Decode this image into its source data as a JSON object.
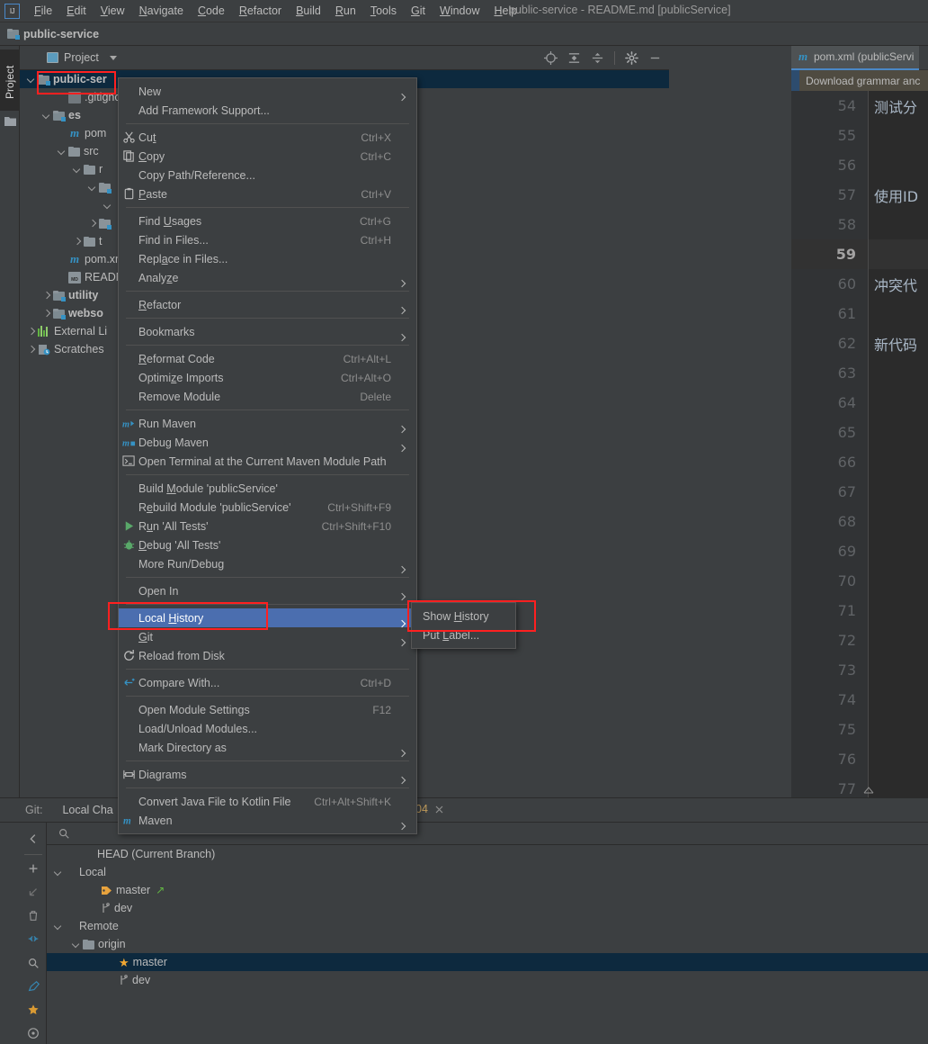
{
  "window": {
    "title": "public-service - README.md [publicService]",
    "logo": "IJ"
  },
  "menubar": {
    "items": [
      {
        "label": "File"
      },
      {
        "label": "Edit"
      },
      {
        "label": "View"
      },
      {
        "label": "Navigate"
      },
      {
        "label": "Code"
      },
      {
        "label": "Refactor"
      },
      {
        "label": "Build"
      },
      {
        "label": "Run"
      },
      {
        "label": "Tools"
      },
      {
        "label": "Git"
      },
      {
        "label": "Window"
      },
      {
        "label": "Help"
      }
    ]
  },
  "navbar": {
    "crumb": "public-service"
  },
  "left_stripe": {
    "tab_label": "Project"
  },
  "project_panel": {
    "title": "Project",
    "tools": [
      "locate-icon",
      "expand-all-icon",
      "collapse-all-icon",
      "settings-icon",
      "hide-icon"
    ],
    "tree": [
      {
        "label": "public-ser",
        "indent": 0,
        "arrow": "down",
        "icon": "module-folder",
        "bold": true,
        "selected": true
      },
      {
        "label": ".gitigno",
        "indent": 2,
        "arrow": "none",
        "icon": "gitignore",
        "bold": false,
        "selected": false
      },
      {
        "label": "es",
        "indent": 1,
        "arrow": "down",
        "icon": "module-folder",
        "bold": true,
        "selected": false
      },
      {
        "label": "pom",
        "indent": 2,
        "arrow": "none",
        "icon": "maven",
        "bold": false,
        "selected": false
      },
      {
        "label": "src",
        "indent": 2,
        "arrow": "down",
        "icon": "folder",
        "bold": false,
        "selected": false
      },
      {
        "label": "r",
        "indent": 3,
        "arrow": "down",
        "icon": "folder",
        "bold": false,
        "selected": false
      },
      {
        "label": "",
        "indent": 4,
        "arrow": "down",
        "icon": "folder-blue",
        "bold": false,
        "selected": false
      },
      {
        "label": "",
        "indent": 5,
        "arrow": "down",
        "icon": "none",
        "bold": false,
        "selected": false
      },
      {
        "label": "",
        "indent": 4,
        "arrow": "right",
        "icon": "folder-blue",
        "bold": false,
        "selected": false
      },
      {
        "label": "t",
        "indent": 3,
        "arrow": "right",
        "icon": "folder",
        "bold": false,
        "selected": false
      },
      {
        "label": "pom.xm",
        "indent": 2,
        "arrow": "none",
        "icon": "maven",
        "bold": false,
        "selected": false
      },
      {
        "label": "READM",
        "indent": 2,
        "arrow": "none",
        "icon": "markdown",
        "bold": false,
        "selected": false
      },
      {
        "label": "utility",
        "indent": 1,
        "arrow": "right",
        "icon": "module-folder",
        "bold": true,
        "selected": false
      },
      {
        "label": "webso",
        "indent": 1,
        "arrow": "right",
        "icon": "module-folder",
        "bold": true,
        "selected": false
      },
      {
        "label": "External Li",
        "indent": 0,
        "arrow": "right",
        "icon": "library",
        "bold": false,
        "selected": false
      },
      {
        "label": "Scratches",
        "indent": 0,
        "arrow": "right",
        "icon": "scratch",
        "bold": false,
        "selected": false
      }
    ]
  },
  "context_menu": {
    "items": [
      {
        "type": "item",
        "label": "New",
        "mnemonic": "",
        "shortcut": "",
        "submenu": true,
        "icon": ""
      },
      {
        "type": "item",
        "label": "Add Framework Support...",
        "shortcut": "",
        "submenu": false,
        "icon": ""
      },
      {
        "type": "separator"
      },
      {
        "type": "item",
        "label": "Cut",
        "mnemonic": "t",
        "shortcut": "Ctrl+X",
        "submenu": false,
        "icon": "scissors-icon"
      },
      {
        "type": "item",
        "label": "Copy",
        "mnemonic": "C",
        "shortcut": "Ctrl+C",
        "submenu": false,
        "icon": "copy-icon"
      },
      {
        "type": "item",
        "label": "Copy Path/Reference...",
        "shortcut": "",
        "submenu": false,
        "icon": ""
      },
      {
        "type": "item",
        "label": "Paste",
        "mnemonic": "P",
        "shortcut": "Ctrl+V",
        "submenu": false,
        "icon": "clipboard-icon"
      },
      {
        "type": "separator"
      },
      {
        "type": "item",
        "label": "Find Usages",
        "mnemonic": "U",
        "shortcut": "Ctrl+G",
        "submenu": false,
        "icon": ""
      },
      {
        "type": "item",
        "label": "Find in Files...",
        "shortcut": "Ctrl+H",
        "submenu": false,
        "icon": ""
      },
      {
        "type": "item",
        "label": "Replace in Files...",
        "mnemonic": "a",
        "shortcut": "",
        "submenu": false,
        "icon": ""
      },
      {
        "type": "item",
        "label": "Analyze",
        "mnemonic": "z",
        "shortcut": "",
        "submenu": true,
        "icon": ""
      },
      {
        "type": "separator"
      },
      {
        "type": "item",
        "label": "Refactor",
        "mnemonic": "R",
        "shortcut": "",
        "submenu": true,
        "icon": ""
      },
      {
        "type": "separator"
      },
      {
        "type": "item",
        "label": "Bookmarks",
        "shortcut": "",
        "submenu": true,
        "icon": ""
      },
      {
        "type": "separator"
      },
      {
        "type": "item",
        "label": "Reformat Code",
        "mnemonic": "R",
        "shortcut": "Ctrl+Alt+L",
        "submenu": false,
        "icon": ""
      },
      {
        "type": "item",
        "label": "Optimize Imports",
        "mnemonic": "z",
        "shortcut": "Ctrl+Alt+O",
        "submenu": false,
        "icon": ""
      },
      {
        "type": "item",
        "label": "Remove Module",
        "shortcut": "Delete",
        "submenu": false,
        "icon": ""
      },
      {
        "type": "separator"
      },
      {
        "type": "item",
        "label": "Run Maven",
        "shortcut": "",
        "submenu": true,
        "icon": "maven-run-icon"
      },
      {
        "type": "item",
        "label": "Debug Maven",
        "shortcut": "",
        "submenu": true,
        "icon": "maven-debug-icon"
      },
      {
        "type": "item",
        "label": "Open Terminal at the Current Maven Module Path",
        "shortcut": "",
        "submenu": false,
        "icon": "terminal-icon"
      },
      {
        "type": "separator"
      },
      {
        "type": "item",
        "label": "Build Module 'publicService'",
        "mnemonic": "M",
        "shortcut": "",
        "submenu": false,
        "icon": ""
      },
      {
        "type": "item",
        "label": "Rebuild Module 'publicService'",
        "mnemonic": "e",
        "shortcut": "Ctrl+Shift+F9",
        "submenu": false,
        "icon": ""
      },
      {
        "type": "item",
        "label": "Run 'All Tests'",
        "mnemonic": "u",
        "shortcut": "Ctrl+Shift+F10",
        "submenu": false,
        "icon": "run-icon"
      },
      {
        "type": "item",
        "label": "Debug 'All Tests'",
        "mnemonic": "D",
        "shortcut": "",
        "submenu": false,
        "icon": "debug-icon"
      },
      {
        "type": "item",
        "label": "More Run/Debug",
        "shortcut": "",
        "submenu": true,
        "icon": ""
      },
      {
        "type": "separator"
      },
      {
        "type": "item",
        "label": "Open In",
        "shortcut": "",
        "submenu": true,
        "icon": ""
      },
      {
        "type": "separator"
      },
      {
        "type": "item",
        "label": "Local History",
        "mnemonic": "H",
        "shortcut": "",
        "submenu": true,
        "icon": "",
        "highlighted": true
      },
      {
        "type": "item",
        "label": "Git",
        "mnemonic": "G",
        "shortcut": "",
        "submenu": true,
        "icon": ""
      },
      {
        "type": "item",
        "label": "Reload from Disk",
        "shortcut": "",
        "submenu": false,
        "icon": "reload-icon"
      },
      {
        "type": "separator"
      },
      {
        "type": "item",
        "label": "Compare With...",
        "shortcut": "Ctrl+D",
        "submenu": false,
        "icon": "compare-icon"
      },
      {
        "type": "separator"
      },
      {
        "type": "item",
        "label": "Open Module Settings",
        "shortcut": "F12",
        "submenu": false,
        "icon": ""
      },
      {
        "type": "item",
        "label": "Load/Unload Modules...",
        "shortcut": "",
        "submenu": false,
        "icon": ""
      },
      {
        "type": "item",
        "label": "Mark Directory as",
        "shortcut": "",
        "submenu": true,
        "icon": ""
      },
      {
        "type": "separator"
      },
      {
        "type": "item",
        "label": "Diagrams",
        "shortcut": "",
        "submenu": true,
        "icon": "diagram-icon"
      },
      {
        "type": "separator"
      },
      {
        "type": "item",
        "label": "Convert Java File to Kotlin File",
        "shortcut": "Ctrl+Alt+Shift+K",
        "submenu": false,
        "icon": ""
      },
      {
        "type": "item",
        "label": "Maven",
        "shortcut": "",
        "submenu": true,
        "icon": "maven-icon"
      }
    ]
  },
  "submenu": {
    "items": [
      {
        "label": "Show History",
        "mnemonic": "H"
      },
      {
        "label": "Put Label...",
        "mnemonic": "L"
      }
    ]
  },
  "editor": {
    "tab_label": "pom.xml (publicServi",
    "notification": "Download grammar anc",
    "lines": [
      {
        "num": "54",
        "text": "测试分",
        "current": false
      },
      {
        "num": "55",
        "text": "",
        "current": false
      },
      {
        "num": "56",
        "text": "",
        "current": false
      },
      {
        "num": "57",
        "text": "使用ID",
        "current": false
      },
      {
        "num": "58",
        "text": "",
        "current": false
      },
      {
        "num": "59",
        "text": "",
        "current": true
      },
      {
        "num": "60",
        "text": "冲突代",
        "current": false
      },
      {
        "num": "61",
        "text": "",
        "current": false
      },
      {
        "num": "62",
        "text": "新代码",
        "current": false
      },
      {
        "num": "63",
        "text": "",
        "current": false
      },
      {
        "num": "64",
        "text": "",
        "current": false
      },
      {
        "num": "65",
        "text": "",
        "current": false
      },
      {
        "num": "66",
        "text": "",
        "current": false
      },
      {
        "num": "67",
        "text": "",
        "current": false
      },
      {
        "num": "68",
        "text": "",
        "current": false
      },
      {
        "num": "69",
        "text": "",
        "current": false
      },
      {
        "num": "70",
        "text": "",
        "current": false
      },
      {
        "num": "71",
        "text": "",
        "current": false
      },
      {
        "num": "72",
        "text": "",
        "current": false
      },
      {
        "num": "73",
        "text": "",
        "current": false
      },
      {
        "num": "74",
        "text": "",
        "current": false
      },
      {
        "num": "75",
        "text": "",
        "current": false
      },
      {
        "num": "76",
        "text": "",
        "current": false
      },
      {
        "num": "77",
        "text": "",
        "current": false
      }
    ]
  },
  "git_panel": {
    "label": "Git:",
    "tab": "Local Cha",
    "extra_tab": "04",
    "search_placeholder": "",
    "tree": [
      {
        "label": "HEAD (Current Branch)",
        "indent": 1,
        "arrow": "none",
        "icon": "none",
        "selected": false
      },
      {
        "label": "Local",
        "indent": 0,
        "arrow": "down",
        "icon": "none",
        "selected": false
      },
      {
        "label": "master",
        "indent": 2,
        "arrow": "none",
        "icon": "tag",
        "selected": false,
        "suffix": "↗"
      },
      {
        "label": "dev",
        "indent": 2,
        "arrow": "none",
        "icon": "branch",
        "selected": false
      },
      {
        "label": "Remote",
        "indent": 0,
        "arrow": "down",
        "icon": "none",
        "selected": false
      },
      {
        "label": "origin",
        "indent": 1,
        "arrow": "down",
        "icon": "folder",
        "selected": false
      },
      {
        "label": "master",
        "indent": 3,
        "arrow": "none",
        "icon": "star",
        "selected": true
      },
      {
        "label": "dev",
        "indent": 3,
        "arrow": "none",
        "icon": "branch",
        "selected": false
      }
    ],
    "side_icons": [
      "back-icon",
      "add-icon",
      "fetch-icon",
      "delete-icon",
      "collapse-icon",
      "search-icon",
      "edit-icon",
      "favorite-icon",
      "settings-icon"
    ]
  },
  "colors": {
    "bg": "#3c3f41",
    "editor_bg": "#2b2b2b",
    "selection": "#0d293e",
    "menu_highlight": "#4b6eaf",
    "accent_blue": "#3592c4",
    "annotation_red": "#ff2020",
    "notification_bg": "#4f4b41"
  }
}
